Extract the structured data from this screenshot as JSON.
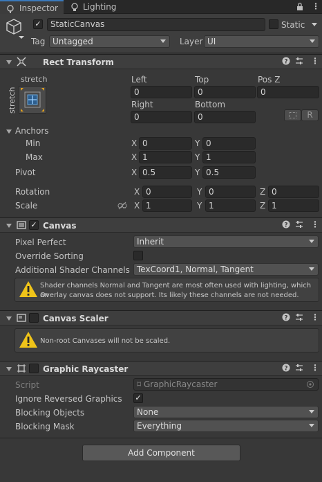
{
  "tabs": [
    {
      "label": "Inspector"
    },
    {
      "label": "Lighting"
    }
  ],
  "gameobject": {
    "name": "StaticCanvas",
    "static_label": "Static",
    "tag_label": "Tag",
    "tag_value": "Untagged",
    "layer_label": "Layer",
    "layer_value": "UI"
  },
  "rect_transform": {
    "title": "Rect Transform",
    "preset_top": "stretch",
    "preset_side": "stretch",
    "left_label": "Left",
    "left_value": "0",
    "top_label": "Top",
    "top_value": "0",
    "posz_label": "Pos Z",
    "posz_value": "0",
    "right_label": "Right",
    "right_value": "0",
    "bottom_label": "Bottom",
    "bottom_value": "0",
    "r_button": "R",
    "anchors_label": "Anchors",
    "min_label": "Min",
    "min_x": "0",
    "min_y": "0",
    "max_label": "Max",
    "max_x": "1",
    "max_y": "1",
    "pivot_label": "Pivot",
    "pivot_x": "0.5",
    "pivot_y": "0.5",
    "rotation_label": "Rotation",
    "rot_x": "0",
    "rot_y": "0",
    "rot_z": "0",
    "scale_label": "Scale",
    "scale_x": "1",
    "scale_y": "1",
    "scale_z": "1",
    "x": "X",
    "y": "Y",
    "z": "Z"
  },
  "canvas": {
    "title": "Canvas",
    "pixel_perfect_label": "Pixel Perfect",
    "pixel_perfect_value": "Inherit",
    "override_sorting_label": "Override Sorting",
    "shader_channels_label": "Additional Shader Channels",
    "shader_channels_value": "TexCoord1, Normal, Tangent",
    "warning_line1": "Shader channels Normal and Tangent are most often used with lighting, which an",
    "warning_line2": "Overlay canvas does not support. Its likely these channels are not needed."
  },
  "canvas_scaler": {
    "title": "Canvas Scaler",
    "warning": "Non-root Canvases will not be scaled."
  },
  "graphic_raycaster": {
    "title": "Graphic Raycaster",
    "script_label": "Script",
    "script_value": "GraphicRaycaster",
    "ignore_reversed_label": "Ignore Reversed Graphics",
    "check": "✓",
    "blocking_objects_label": "Blocking Objects",
    "blocking_objects_value": "None",
    "blocking_mask_label": "Blocking Mask",
    "blocking_mask_value": "Everything"
  },
  "add_component_label": "Add Component",
  "colors": {
    "accent": "#3a79bb",
    "background": "#383838",
    "header": "#3e3e3e",
    "warning": "#f0c419"
  }
}
